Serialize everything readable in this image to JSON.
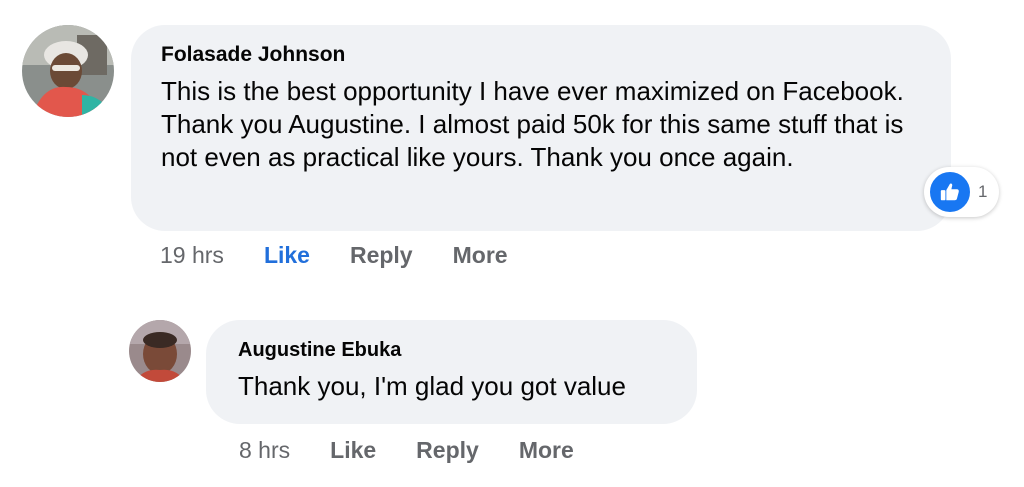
{
  "comments": [
    {
      "author": "Folasade Johnson",
      "text": "This is the best opportunity I have ever maximized on Facebook. Thank you Augustine. I almost paid 50k for this same stuff that is not even as practical like yours. Thank you once again.",
      "time": "19 hrs",
      "like_label": "Like",
      "reply_label": "Reply",
      "more_label": "More",
      "liked": true,
      "reaction_count": "1"
    },
    {
      "author": "Augustine Ebuka",
      "text": "Thank you, I'm glad you got value",
      "time": "8 hrs",
      "like_label": "Like",
      "reply_label": "Reply",
      "more_label": "More",
      "liked": false
    }
  ],
  "colors": {
    "bubble": "#f0f2f5",
    "secondary_text": "#65676b",
    "liked_blue": "#216fdb",
    "reaction_blue": "#1877f2"
  },
  "icons": {
    "reaction": "thumbs-up-icon"
  }
}
